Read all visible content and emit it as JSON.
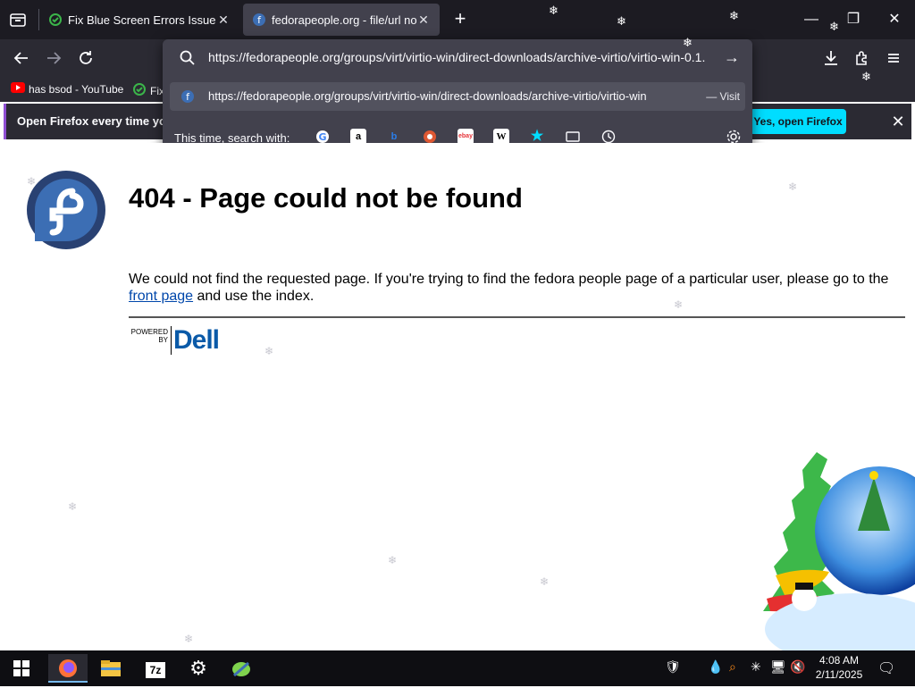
{
  "browser": {
    "tabs": [
      {
        "title": "Fix Blue Screen Errors Issues.",
        "close": "✕",
        "active": false
      },
      {
        "title": "fedorapeople.org - file/url not f",
        "close": "✕",
        "active": true
      }
    ],
    "new_tab": "+",
    "window_controls": {
      "minimize": "—",
      "maximize": "❐",
      "close": "✕"
    }
  },
  "url_panel": {
    "url": "https://fedorapeople.org/groups/virt/virtio-win/direct-downloads/archive-virtio/virtio-win-0.1.",
    "suggestion_url": "https://fedorapeople.org/groups/virt/virtio-win/direct-downloads/archive-virtio/virtio-win",
    "suggestion_action": "— Visit",
    "search_with_label": "This time, search with:",
    "engines": [
      "google",
      "amazon",
      "bing",
      "duckduckgo",
      "ebay",
      "wikipedia",
      "bookmarks",
      "tabs",
      "history"
    ]
  },
  "bookmarks": [
    {
      "label": "has bsod - YouTube",
      "icon": "youtube-icon"
    },
    {
      "label": "Fix",
      "icon": "shield-icon"
    }
  ],
  "notification": {
    "text": "Open Firefox every time you",
    "button": "Yes, open Firefox",
    "close": "✕"
  },
  "page": {
    "heading": "404 - Page could not be found",
    "message_before_link": "We could not find the requested page. If you're trying to find the fedora people page of a particular user, please go to the ",
    "link_text": "front page",
    "message_after_link": " and use the index.",
    "powered_by_line1": "POWERED",
    "powered_by_line2": "BY",
    "dell": "Dell"
  },
  "taskbar": {
    "time": "4:08 AM",
    "date": "2/11/2025",
    "sevenzip": "7z"
  },
  "colors": {
    "tab_bg": "#1c1b22",
    "toolbar_bg": "#2b2a33",
    "panel_bg": "#42414d",
    "accent_button": "#00ddff",
    "link": "#0047ab",
    "dell_blue": "#0a5aa8"
  }
}
